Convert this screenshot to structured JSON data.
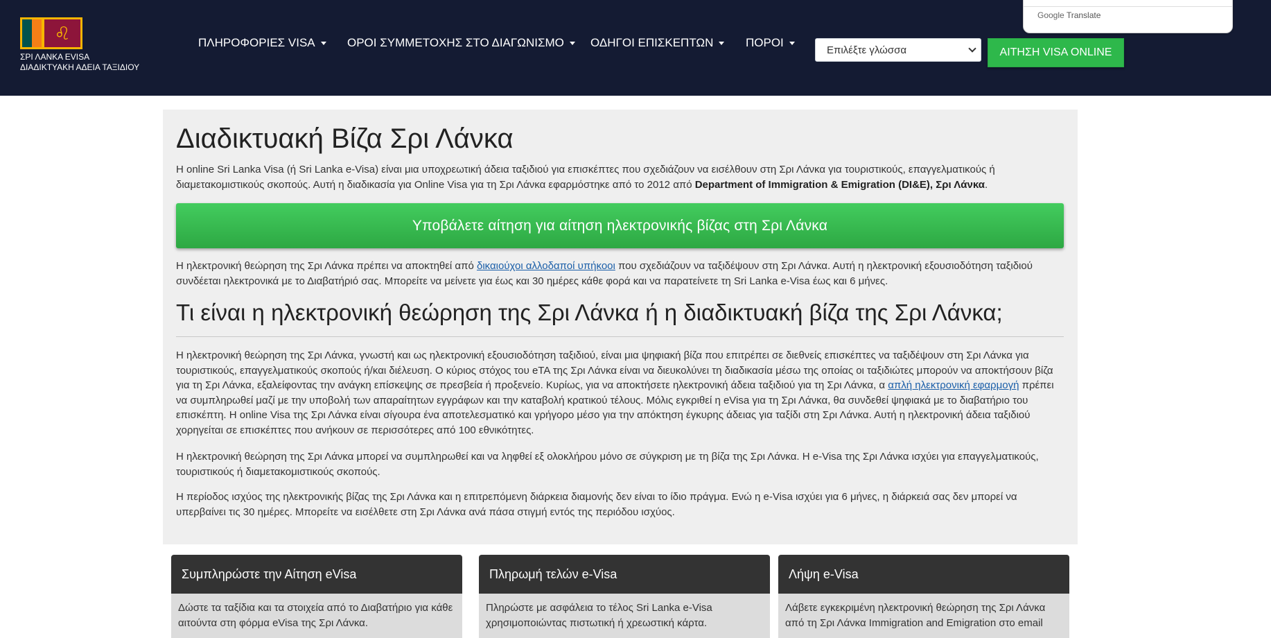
{
  "header": {
    "logo_line1": "ΣΡΙ ΛΑΝΚΑ EVISA",
    "logo_line2": "ΔΙΑΔΙΚΤΥΑΚΗ ΑΔΕΙΑ ΤΑΞΙΔΙΟΥ",
    "flag_symbol": "♌",
    "nav": [
      {
        "label": "ΠΛΗΡΟΦΟΡΙΕΣ VISA"
      },
      {
        "label": "ΟΡΟΙ ΣΥΜΜΕΤΟΧΗΣ ΣΤΟ ΔΙΑΓΩΝΙΣΜΟ"
      },
      {
        "label": "ΟΔΗΓΟΙ ΕΠΙΣΚΕΠΤΩΝ"
      },
      {
        "label": "ΠΟΡΟΙ"
      }
    ],
    "language_select": "Επιλέξτε γλώσσα",
    "apply_button": "ΑΙΤΗΣΗ VISA ONLINE",
    "google_translate": {
      "brand": "Google",
      "label": "Translate"
    }
  },
  "main": {
    "title": "Διαδικτυακή Βίζα Σρι Λάνκα",
    "intro_part1": "Η online Sri Lanka Visa (ή Sri Lanka e-Visa) είναι μια υποχρεωτική άδεια ταξιδιού για επισκέπτες που σχεδιάζουν να εισέλθουν στη Σρι Λάνκα για τουριστικούς, επαγγελματικούς ή διαμετακομιστικούς σκοπούς. Αυτή η διαδικασία για Online Visa για τη Σρι Λάνκα εφαρμόστηκε από το 2012 από ",
    "intro_bold": "Department of Immigration & Emigration (DI&E), Σρι Λάνκα",
    "intro_end": ".",
    "apply_big_button": "Υποβάλετε αίτηση για αίτηση ηλεκτρονικής βίζας στη Σρι Λάνκα",
    "para2_part1": "Η ηλεκτρονική θεώρηση της Σρι Λάνκα πρέπει να αποκτηθεί από ",
    "para2_link": "δικαιούχοι αλλοδαποί υπήκοοι",
    "para2_part2": " που σχεδιάζουν να ταξιδέψουν στη Σρι Λάνκα. Αυτή η ηλεκτρονική εξουσιοδότηση ταξιδιού συνδέεται ηλεκτρονικά με το Διαβατήριό σας. Μπορείτε να μείνετε για έως και 30 ημέρες κάθε φορά και να παρατείνετε τη Sri Lanka e-Visa έως και 6 μήνες.",
    "heading2": "Τι είναι η ηλεκτρονική θεώρηση της Σρι Λάνκα ή η διαδικτυακή βίζα της Σρι Λάνκα;",
    "para3_part1": "Η ηλεκτρονική θεώρηση της Σρι Λάνκα, γνωστή και ως ηλεκτρονική εξουσιοδότηση ταξιδιού, είναι μια ψηφιακή βίζα που επιτρέπει σε διεθνείς επισκέπτες να ταξιδέψουν στη Σρι Λάνκα για τουριστικούς, επαγγελματικούς σκοπούς ή/και διέλευση. Ο κύριος στόχος του eTA της Σρι Λάνκα είναι να διευκολύνει τη διαδικασία μέσω της οποίας οι ταξιδιώτες μπορούν να αποκτήσουν βίζα για τη Σρι Λάνκα, εξαλείφοντας την ανάγκη επίσκεψης σε πρεσβεία ή προξενείο. Κυρίως, για να αποκτήσετε ηλεκτρονική άδεια ταξιδιού για τη Σρι Λάνκα, α ",
    "para3_link": "απλή ηλεκτρονική εφαρμογή",
    "para3_part2": " πρέπει να συμπληρωθεί μαζί με την υποβολή των απαραίτητων εγγράφων και την καταβολή κρατικού τέλους. Μόλις εγκριθεί η eVisa για τη Σρι Λάνκα, θα συνδεθεί ψηφιακά με το διαβατήριο του επισκέπτη. Η online Visa της Σρι Λάνκα είναι σίγουρα ένα αποτελεσματικό και γρήγορο μέσο για την απόκτηση έγκυρης άδειας για ταξίδι στη Σρι Λάνκα. Αυτή η ηλεκτρονική άδεια ταξιδιού χορηγείται σε επισκέπτες που ανήκουν σε περισσότερες από 100 εθνικότητες.",
    "para4": "Η ηλεκτρονική θεώρηση της Σρι Λάνκα μπορεί να συμπληρωθεί και να ληφθεί εξ ολοκλήρου μόνο σε σύγκριση με τη βίζα της Σρι Λάνκα. Η e-Visa της Σρι Λάνκα ισχύει για επαγγελματικούς, τουριστικούς ή διαμετακομιστικούς σκοπούς.",
    "para5": "Η περίοδος ισχύος της ηλεκτρονικής βίζας της Σρι Λάνκα και η επιτρεπόμενη διάρκεια διαμονής δεν είναι το ίδιο πράγμα. Ενώ η e-Visa ισχύει για 6 μήνες, η διάρκειά σας δεν μπορεί να υπερβαίνει τις 30 ημέρες. Μπορείτε να εισέλθετε στη Σρι Λάνκα ανά πάσα στιγμή εντός της περιόδου ισχύος."
  },
  "cards": [
    {
      "title": "Συμπληρώστε την Αίτηση eVisa",
      "body": "Δώστε τα ταξίδια και τα στοιχεία από το Διαβατήριο για κάθε αιτούντα στη φόρμα eVisa της Σρι Λάνκα."
    },
    {
      "title": "Πληρωμή τελών e-Visa",
      "body": "Πληρώστε με ασφάλεια το τέλος Sri Lanka e-Visa χρησιμοποιώντας πιστωτική ή χρεωστική κάρτα."
    },
    {
      "title": "Λήψη e-Visa",
      "body": "Λάβετε εγκεκριμένη ηλεκτρονική θεώρηση της Σρι Λάνκα από τη Σρι Λάνκα Immigration and Emigration στο email"
    }
  ]
}
